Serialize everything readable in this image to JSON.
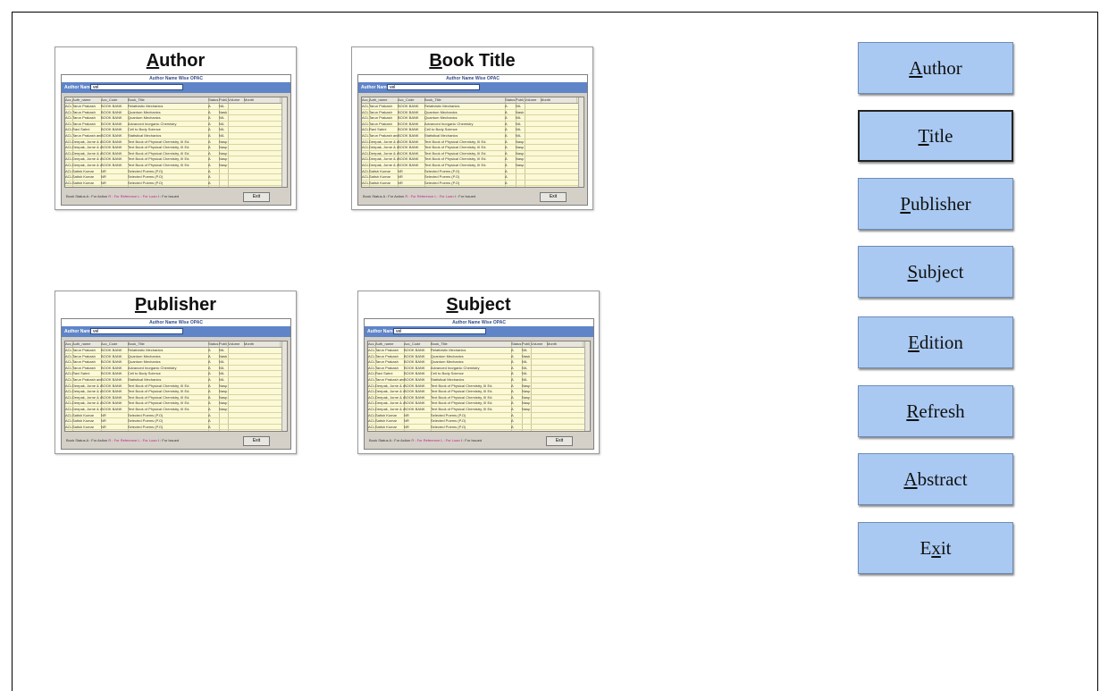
{
  "thumbnails": [
    {
      "id": "author",
      "hotkey": "A",
      "rest": "uthor",
      "window_caption": "Author Name Wise OPAC",
      "field_label": "Author Name",
      "field_value": "vel",
      "footer_button": "Exit"
    },
    {
      "id": "book-title",
      "hotkey": "B",
      "rest": "ook Title",
      "window_caption": "Author Name Wise OPAC",
      "field_label": "Author Name",
      "field_value": "vel",
      "footer_button": "Exit"
    },
    {
      "id": "publisher",
      "hotkey": "P",
      "rest": "ublisher",
      "window_caption": "Author Name Wise OPAC",
      "field_label": "Author Name",
      "field_value": "vel",
      "footer_button": "Exit"
    },
    {
      "id": "subject",
      "hotkey": "S",
      "rest": "ubject",
      "window_caption": "Author Name Wise OPAC",
      "field_label": "Author Name",
      "field_value": "vel",
      "footer_button": "Exit"
    }
  ],
  "grid_headers": [
    "Acc_No",
    "Auth_name",
    "Acc_Code",
    "Book_Title",
    "Status",
    "Publi_Yr",
    "Volume",
    "Month"
  ],
  "grid_rows": [
    [
      "ACL1",
      "Tarun Prakash",
      "BOOK BANK",
      "Relativistic Mechanics",
      "A",
      "NIL"
    ],
    [
      "ACL1",
      "Tarun Prakash",
      "BOOK BANK",
      "Quantum Mechanics",
      "A",
      "Nask"
    ],
    [
      "ACL1",
      "Tarun Prakash",
      "BOOK BANK",
      "Quantum Mechanics",
      "A",
      "NIL"
    ],
    [
      "ACL1",
      "Tarun Prakash",
      "BOOK BANK",
      "Advanced Inorganic Chemistry",
      "A",
      "NIL"
    ],
    [
      "ACL1",
      "Ravi Sahni",
      "BOOK BANK",
      "Cell to Body Science",
      "A",
      "NIL"
    ],
    [
      "ACL1",
      "Tarun Prakash and J.P. Agrawal",
      "BOOK BANK",
      "Statistical Mechanics",
      "A",
      "NIL"
    ],
    [
      "ACL1",
      "Deepak, Jorne & other",
      "BOOK BANK",
      "Text Book of Physical Chemistry, III Ed.",
      "A",
      "Nasp"
    ],
    [
      "ACL1",
      "Deepak, Jorne & other",
      "BOOK BANK",
      "Text Book of Physical Chemistry, III Ed.",
      "A",
      "Nasp"
    ],
    [
      "ACL1",
      "Deepak, Jorne & other",
      "BOOK BANK",
      "Text Book of Physical Chemistry, III Ed.",
      "A",
      "Nasp"
    ],
    [
      "ACL1",
      "Deepak, Jorne & other",
      "BOOK BANK",
      "Text Book of Physical Chemistry, III Ed.",
      "A",
      "Nasp"
    ],
    [
      "ACL1",
      "Deepak, Jorne & other",
      "BOOK BANK",
      "Text Book of Physical Chemistry, III Ed.",
      "A",
      "Nasp"
    ],
    [
      "ACL1",
      "Satish Kumar",
      "NR",
      "Selected Poems (P.O)",
      "A",
      ""
    ],
    [
      "ACL1",
      "Satish Kumar",
      "NR",
      "Selected Poems (P.O)",
      "A",
      ""
    ],
    [
      "ACL1",
      "Satish Kumar",
      "NR",
      "Selected Poems (P.O)",
      "A",
      ""
    ],
    [
      "ACL1",
      "Satish Kumar",
      "NR",
      "Selected Poems (P.O)",
      "A",
      ""
    ],
    [
      "ACL1",
      "Satish Kumar",
      "NR",
      "Selected Poems (P.O)",
      "A",
      ""
    ],
    [
      "ACL1",
      "Satish Kumar",
      "NR",
      "Selected Poems (P.O)",
      "A",
      ""
    ],
    [
      "ACL1",
      "Satish Verma",
      "USO",
      "Method Measurement And Evaluation in Physics",
      "A",
      "Nasp"
    ],
    [
      "ACL1",
      "Tarun Prakash",
      "BOOK BANK",
      "Advanced Quantum Mechanics",
      "A",
      "Jarel"
    ]
  ],
  "footer_legend": {
    "label": "Book Status",
    "a": "A : For Action",
    "r": "R : For Reference",
    "l": "L : For Loan",
    "i": "I : For Issued"
  },
  "side_buttons": [
    {
      "id": "author",
      "pre": "",
      "key": "A",
      "post": "uthor",
      "selected": false
    },
    {
      "id": "title",
      "pre": "",
      "key": "T",
      "post": "itle",
      "selected": true
    },
    {
      "id": "publisher",
      "pre": "",
      "key": "P",
      "post": "ublisher",
      "selected": false
    },
    {
      "id": "subject",
      "pre": "",
      "key": "S",
      "post": "ubject",
      "selected": false
    },
    {
      "id": "edition",
      "pre": "",
      "key": "E",
      "post": "dition",
      "selected": false
    },
    {
      "id": "refresh",
      "pre": "",
      "key": "R",
      "post": "efresh",
      "selected": false
    },
    {
      "id": "abstract",
      "pre": "",
      "key": "A",
      "post": "bstract",
      "selected": false
    },
    {
      "id": "exit",
      "pre": "E",
      "key": "x",
      "post": "it",
      "selected": false
    }
  ]
}
